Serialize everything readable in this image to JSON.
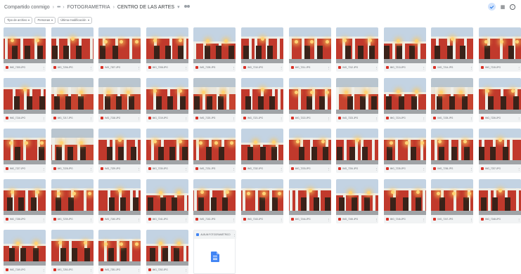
{
  "breadcrumb": {
    "root": "Compartido conmigo",
    "parent": "FOTOGRAMETRIA",
    "current": "CENTRO DE LAS ARTES"
  },
  "filters": [
    {
      "label": "Tipo de archivo"
    },
    {
      "label": "Personas"
    },
    {
      "label": "Última modificación"
    }
  ],
  "files": [
    {
      "name": "IMG_7205.JPG",
      "variant": 1
    },
    {
      "name": "IMG_7206.JPG",
      "variant": 2
    },
    {
      "name": "IMG_7207.JPG",
      "variant": 3
    },
    {
      "name": "IMG_7208.JPG",
      "variant": 1
    },
    {
      "name": "IMG_7209.JPG",
      "variant": 4
    },
    {
      "name": "IMG_7210.JPG",
      "variant": 2
    },
    {
      "name": "IMG_7211.JPG",
      "variant": 3
    },
    {
      "name": "IMG_7212.JPG",
      "variant": 1
    },
    {
      "name": "IMG_7213.JPG",
      "variant": 4
    },
    {
      "name": "IMG_7214.JPG",
      "variant": 2
    },
    {
      "name": "IMG_7215.JPG",
      "variant": 3
    },
    {
      "name": "IMG_7216.JPG",
      "variant": 2
    },
    {
      "name": "IMG_7217.JPG",
      "variant": 5
    },
    {
      "name": "IMG_7218.JPG",
      "variant": 5
    },
    {
      "name": "IMG_7219.JPG",
      "variant": 1
    },
    {
      "name": "IMG_7220.JPG",
      "variant": 5
    },
    {
      "name": "IMG_7221.JPG",
      "variant": 2
    },
    {
      "name": "IMG_7222.JPG",
      "variant": 3
    },
    {
      "name": "IMG_7223.JPG",
      "variant": 5
    },
    {
      "name": "IMG_7224.JPG",
      "variant": 4
    },
    {
      "name": "IMG_7225.JPG",
      "variant": 5
    },
    {
      "name": "IMG_7226.JPG",
      "variant": 1
    },
    {
      "name": "IMG_7227.JPG",
      "variant": 3
    },
    {
      "name": "IMG_7228.JPG",
      "variant": 5
    },
    {
      "name": "IMG_7229.JPG",
      "variant": 2
    },
    {
      "name": "IMG_7230.JPG",
      "variant": 1
    },
    {
      "name": "IMG_7231.JPG",
      "variant": 3
    },
    {
      "name": "IMG_7232.JPG",
      "variant": 4
    },
    {
      "name": "IMG_7233.JPG",
      "variant": 1
    },
    {
      "name": "IMG_7234.JPG",
      "variant": 2
    },
    {
      "name": "IMG_7235.JPG",
      "variant": 3
    },
    {
      "name": "IMG_7236.JPG",
      "variant": 1
    },
    {
      "name": "IMG_7237.JPG",
      "variant": 2
    },
    {
      "name": "IMG_7238.JPG",
      "variant": 1
    },
    {
      "name": "IMG_7239.JPG",
      "variant": 3
    },
    {
      "name": "IMG_7240.JPG",
      "variant": 2
    },
    {
      "name": "IMG_7241.JPG",
      "variant": 4
    },
    {
      "name": "IMG_7242.JPG",
      "variant": 1
    },
    {
      "name": "IMG_7243.JPG",
      "variant": 3
    },
    {
      "name": "IMG_7244.JPG",
      "variant": 2
    },
    {
      "name": "IMG_7245.JPG",
      "variant": 4
    },
    {
      "name": "IMG_7246.JPG",
      "variant": 1
    },
    {
      "name": "IMG_7247.JPG",
      "variant": 3
    },
    {
      "name": "IMG_7248.JPG",
      "variant": 2
    },
    {
      "name": "IMG_7249.JPG",
      "variant": 4
    },
    {
      "name": "IMG_7250.JPG",
      "variant": 1
    },
    {
      "name": "IMG_7251.JPG",
      "variant": 3
    },
    {
      "name": "IMG_7252.JPG",
      "variant": 4
    }
  ],
  "document": {
    "name": "ALBUM FOTOGRAMETRICO"
  },
  "colors": {
    "accent": "#1a73e8",
    "image_icon": "#d93025",
    "doc_icon": "#4285f4"
  },
  "icons": {
    "shared": "people-icon",
    "view_toggle": "check-icon",
    "grid_view": "grid-icon",
    "details": "info-icon"
  }
}
